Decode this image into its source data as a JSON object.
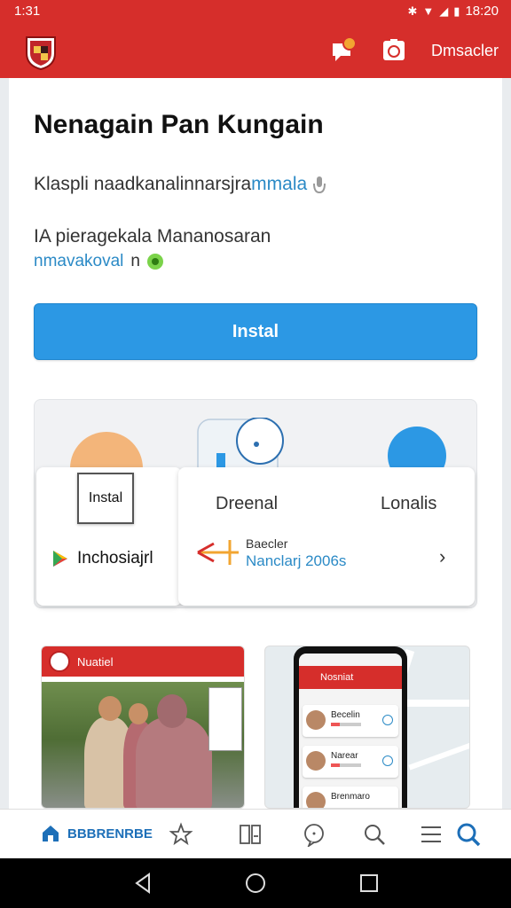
{
  "status_bar": {
    "time": "1:31",
    "clock": "18:20"
  },
  "app_bar": {
    "action_label": "Dmsacler"
  },
  "main": {
    "title": "Nenagain Pan Kungain",
    "subtitle_plain": "Klaspli naadkanalinnarsjra",
    "subtitle_highlight": "mmala",
    "line1": "IA pieragekala Mananosaran",
    "line2_link": "nmavakoval",
    "line2_text": "n",
    "install_label": "Instal"
  },
  "features": {
    "install_box_label": "Instal",
    "store_label": "Inchosiajrl",
    "tab_a": "Dreenal",
    "tab_b": "Lonalis",
    "info_small": "Baecler",
    "info_link": "Nanclarj 2006s"
  },
  "screenshots": {
    "left_bar_label": "Nuatiel",
    "right_bar_label": "Nosniat",
    "items": [
      "Becelin",
      "Narear",
      "Brenmaro"
    ]
  },
  "bottom_nav": {
    "home_label": "BBBRENRBE"
  },
  "colors": {
    "brand_red": "#d62e2b",
    "accent_blue": "#2c98e4",
    "link_blue": "#2b8ac6"
  }
}
